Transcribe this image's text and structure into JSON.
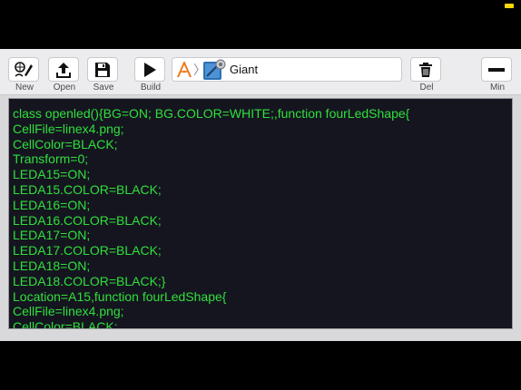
{
  "toolbar": {
    "new_label": "New",
    "open_label": "Open",
    "save_label": "Save",
    "build_label": "Build",
    "del_label": "Del",
    "min_label": "Min"
  },
  "path": {
    "project_name": "Giant",
    "separator": "〉"
  },
  "editor": {
    "lines": [
      "class openled(){BG=ON; BG.COLOR=WHITE;,function fourLedShape{",
      "CellFile=linex4.png;",
      "CellColor=BLACK;",
      "Transform=0;",
      "LEDA15=ON;",
      "LEDA15.COLOR=BLACK;",
      "LEDA16=ON;",
      "LEDA16.COLOR=BLACK;",
      "LEDA17=ON;",
      "LEDA17.COLOR=BLACK;",
      "LEDA18=ON;",
      "LEDA18.COLOR=BLACK;}",
      "Location=A15,function fourLedShape{",
      "CellFile=linex4.png;",
      "CellColor=BLACK;"
    ]
  },
  "colors": {
    "code_text": "#2fe03a",
    "editor_bg": "#151520",
    "toolbar_bg": "#ececef"
  },
  "icons": {
    "new": "brush-pen-icon",
    "open": "upload-arrow-icon",
    "save": "floppy-disk-icon",
    "build": "play-icon",
    "app": "compass-a-icon",
    "project": "project-drawing-icon",
    "del": "trash-icon",
    "min": "minus-icon"
  }
}
